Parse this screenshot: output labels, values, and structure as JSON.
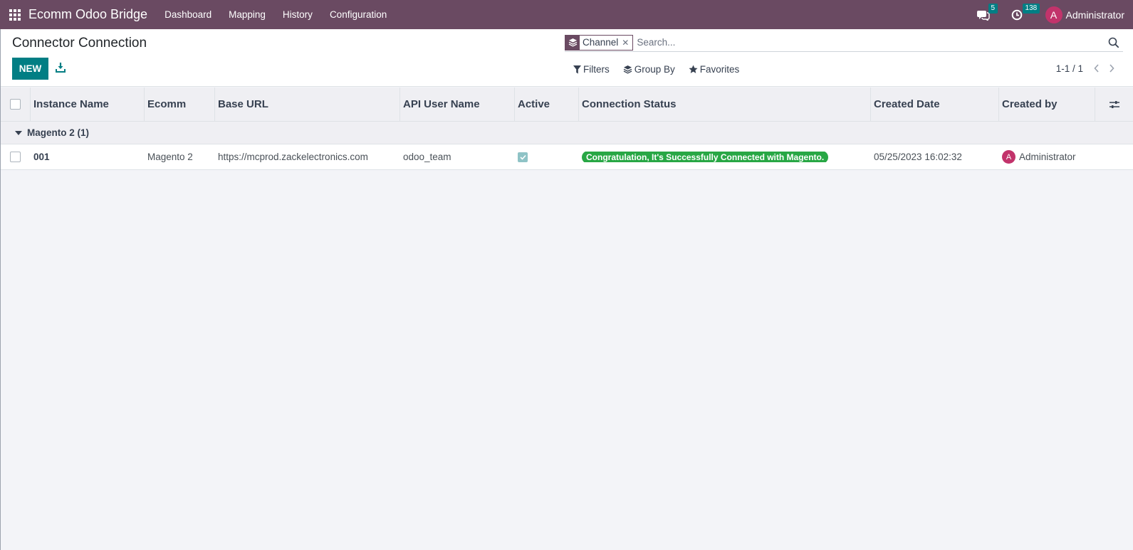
{
  "navbar": {
    "app_name": "Ecomm Odoo Bridge",
    "menu": [
      "Dashboard",
      "Mapping",
      "History",
      "Configuration"
    ],
    "messages_count": "5",
    "activities_count": "138",
    "user_initial": "A",
    "user_name": "Administrator",
    "bg_color": "#6a4a62"
  },
  "control_panel": {
    "title": "Connector Connection",
    "new_label": "NEW",
    "search": {
      "facet_label": "Channel",
      "facet_icon": "layers-icon",
      "placeholder": "Search..."
    },
    "filters_label": "Filters",
    "group_by_label": "Group By",
    "favorites_label": "Favorites",
    "pager": "1-1 / 1"
  },
  "table": {
    "columns": [
      "Instance Name",
      "Ecomm",
      "Base URL",
      "API User Name",
      "Active",
      "Connection Status",
      "Created Date",
      "Created by"
    ],
    "groups": [
      {
        "label": "Magento 2 (1)",
        "rows": [
          {
            "instance_name": "001",
            "ecomm": "Magento 2",
            "base_url": "https://mcprod.zackelectronics.com",
            "api_user": "odoo_team",
            "active": true,
            "status": "Congratulation, It's Successfully Connected with Magento.",
            "created_date": "05/25/2023 16:02:32",
            "created_by_initial": "A",
            "created_by": "Administrator"
          }
        ]
      }
    ]
  },
  "colors": {
    "primary": "#017e84",
    "status_success": "#28a745",
    "avatar": "#c2336b"
  }
}
